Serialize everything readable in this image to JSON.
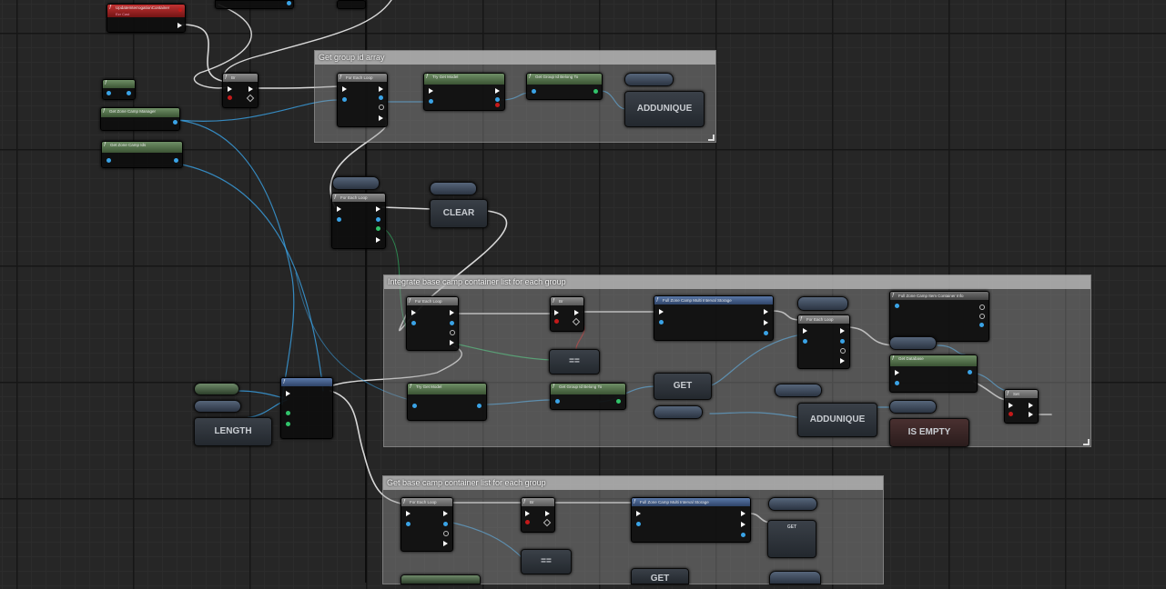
{
  "comments": {
    "get_group_id_array": "Get group id array",
    "integrate": "Integrate base camp container list for each group",
    "get_base_camp": "Get base camp container list for each group"
  },
  "nodes": {
    "update_event": "UpdateInterrogationContainer",
    "update_event_sub": "Ezr Cast",
    "branch": "Br",
    "get_zone_camp_manager": "Get Zone Camp Manager",
    "get_zone_camp_ids": "Get Zone Camp Ids",
    "for_each_loop": "For Each Loop",
    "try_get_model": "Try Get Model",
    "get_group_id_belong_to": "Get Group Id Belong To",
    "for_each_loop_clear": "For Each Loop",
    "full_zone_camp": "Full Zone Camp Multi Interval Storage",
    "for_each_loop_2": "For Each Loop",
    "full_zone_container_info": "Full Zone Camp Item Container Info",
    "get_database": "Get Database",
    "try_get_model_2": "Try Get Model",
    "get_group_id_belong_to_2": "Get Group Id Belong To",
    "for_each_loop_3": "For Each Loop",
    "full_zone_camp_2": "Full Zone Camp Multi Interval Storage",
    "set_node": "Set"
  },
  "macros": {
    "addunique_1": "ADDUNIQUE",
    "clear": "CLEAR",
    "length": "LENGTH",
    "eq_1": "==",
    "get_1": "GET",
    "addunique_2": "ADDUNIQUE",
    "is_empty": "IS EMPTY",
    "eq_2": "==",
    "get_2": "GET",
    "get_3": "GET"
  },
  "colors": {
    "grid_bg": "#262626",
    "comment_bg": "#969696",
    "exec_wire": "#ffffff",
    "object_wire": "#3aa3e6",
    "int_wire": "#31c46b",
    "bool_wire": "#c41a1a",
    "event_red": "#c23232",
    "pure_green": "#6f8f66"
  }
}
